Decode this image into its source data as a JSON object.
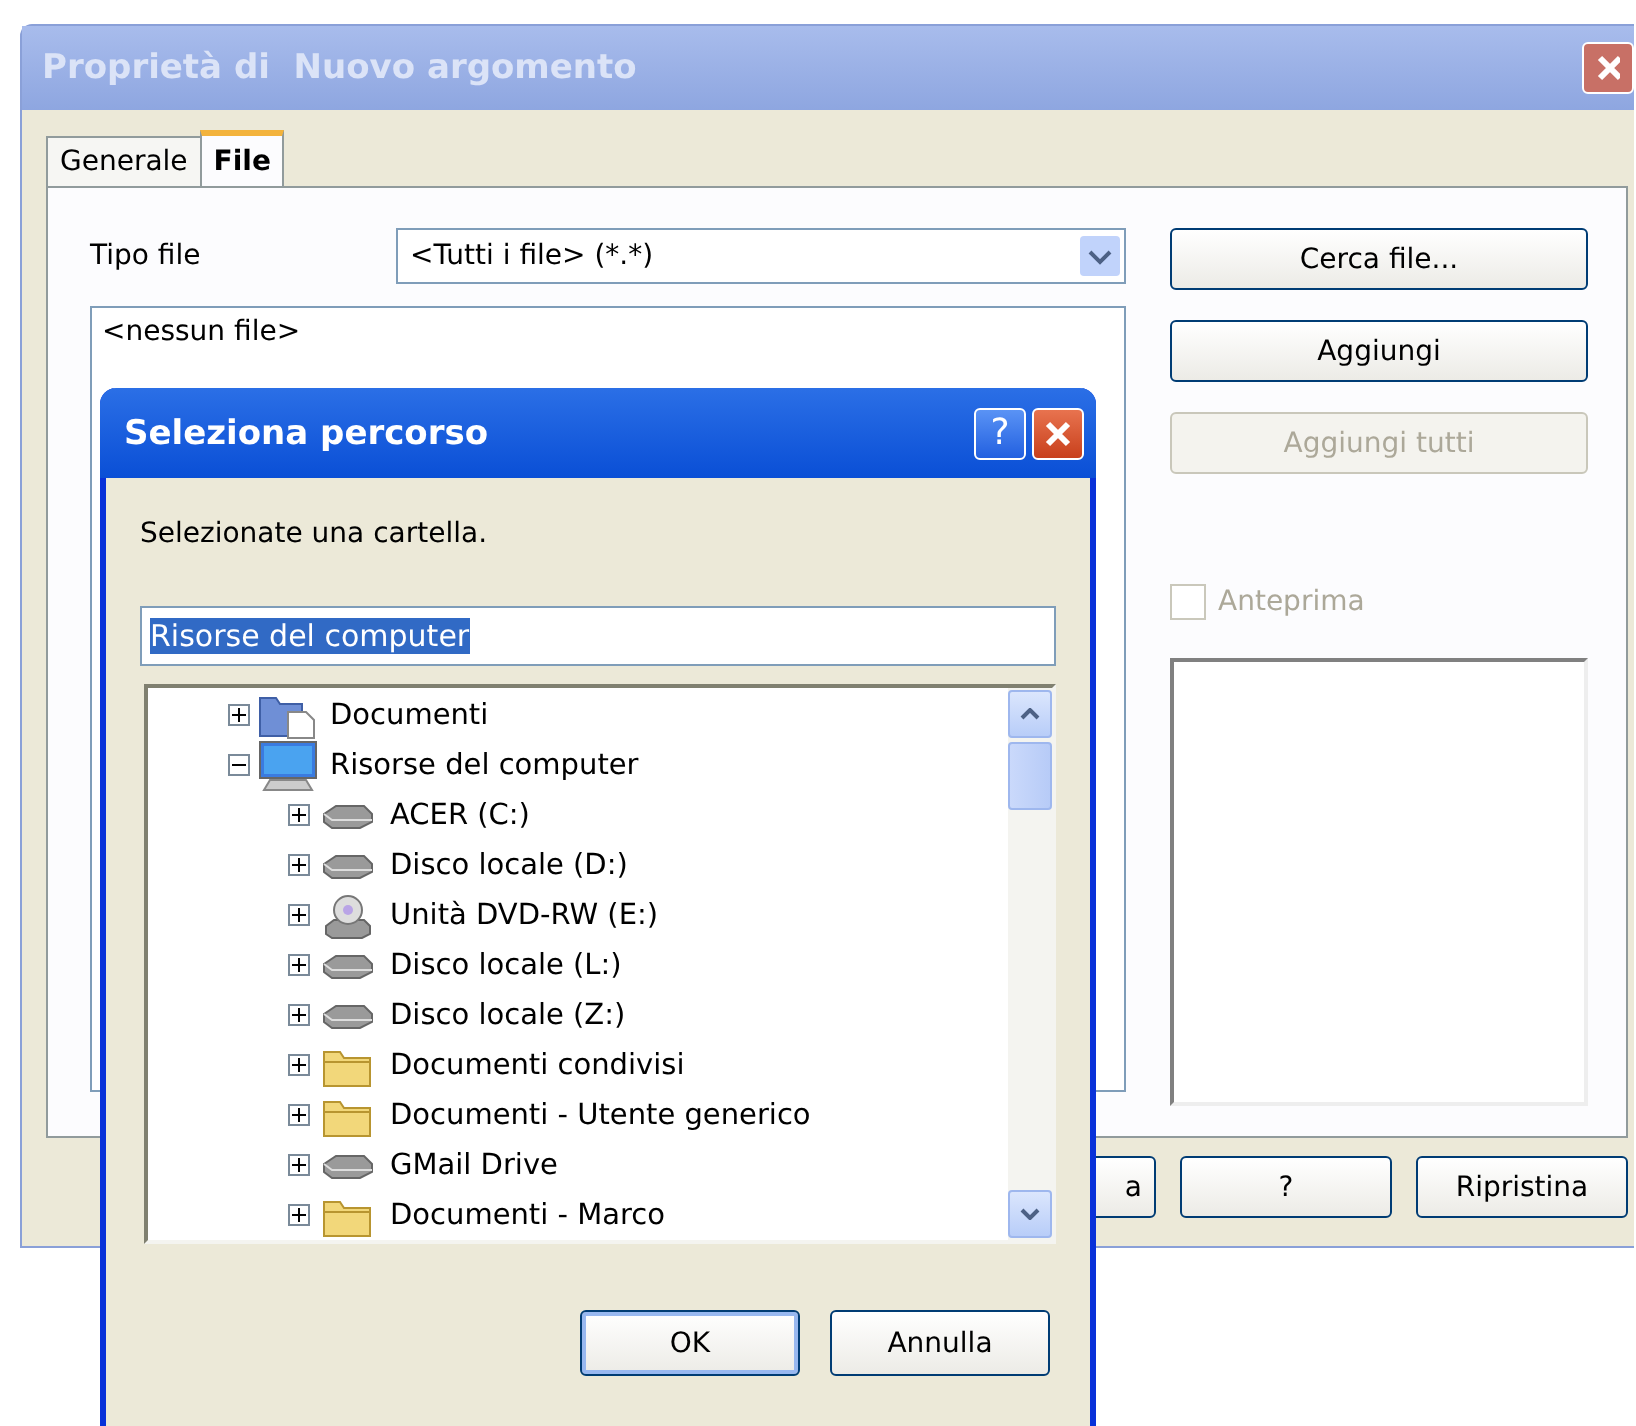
{
  "back_window": {
    "title": "Proprietà di  Nuovo argomento",
    "active": false,
    "tabs": [
      {
        "label": "Generale",
        "selected": false
      },
      {
        "label": "File",
        "selected": true
      }
    ],
    "file_type": {
      "label": "Tipo file",
      "value": "<Tutti i file> (*.*)"
    },
    "file_list": [
      "<nessun file>"
    ],
    "side_buttons": [
      {
        "label": "Cerca file...",
        "disabled": false
      },
      {
        "label": "Aggiungi",
        "disabled": false
      },
      {
        "label": "Aggiungi tutti",
        "disabled": true
      }
    ],
    "preview": {
      "label": "Anteprima",
      "checked": false,
      "disabled": true
    },
    "bottom_buttons": [
      "a",
      "?",
      "Ripristina"
    ]
  },
  "dialog": {
    "title": "Seleziona percorso",
    "help_label": "?",
    "prompt": "Selezionate una cartella.",
    "path": {
      "value": "Risorse del computer",
      "selected": true
    },
    "tree": [
      {
        "label": "Documenti",
        "kind": "documents",
        "expanded": false
      },
      {
        "label": "Risorse del computer",
        "kind": "computer",
        "expanded": true,
        "children": [
          {
            "label": "ACER (C:)",
            "kind": "drive",
            "expanded": false
          },
          {
            "label": "Disco locale (D:)",
            "kind": "drive",
            "expanded": false
          },
          {
            "label": "Unità DVD-RW (E:)",
            "kind": "dvd",
            "expanded": false
          },
          {
            "label": "Disco locale (L:)",
            "kind": "drive",
            "expanded": false
          },
          {
            "label": "Disco locale (Z:)",
            "kind": "drive",
            "expanded": false
          },
          {
            "label": "Documenti condivisi",
            "kind": "folder",
            "expanded": false
          },
          {
            "label": "Documenti - Utente generico",
            "kind": "folder",
            "expanded": false
          },
          {
            "label": "GMail Drive",
            "kind": "drive",
            "expanded": false
          },
          {
            "label": "Documenti - Marco",
            "kind": "folder",
            "expanded": false
          }
        ]
      }
    ],
    "buttons": [
      {
        "label": "OK",
        "default": true
      },
      {
        "label": "Annulla",
        "default": false
      }
    ]
  }
}
